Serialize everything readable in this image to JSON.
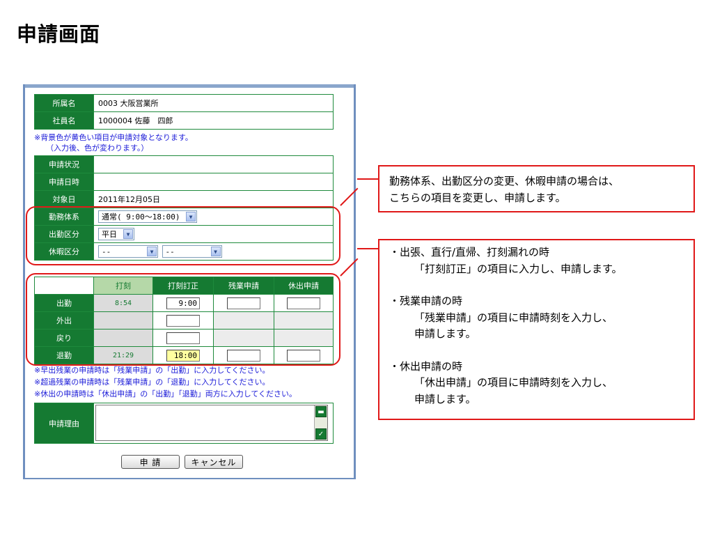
{
  "title": "申請画面",
  "form": {
    "affiliation": {
      "label": "所属名",
      "value": "0003 大阪営業所"
    },
    "employee": {
      "label": "社員名",
      "value": "1000004 佐藤　四郎"
    },
    "note_top_1": "※背景色が黄色い項目が申請対象となります。",
    "note_top_2": "（入力後、色が変わります。）",
    "status": {
      "label": "申請状況",
      "value": ""
    },
    "apply_date": {
      "label": "申請日時",
      "value": ""
    },
    "target_date": {
      "label": "対象日",
      "value": "2011年12月05日"
    },
    "work_system": {
      "label": "勤務体系",
      "value": "通常( 9:00～18:00)"
    },
    "attendance_type": {
      "label": "出勤区分",
      "value": "平日"
    },
    "leave_type": {
      "label": "休暇区分",
      "value1": "--",
      "value2": "--"
    }
  },
  "grid": {
    "headers": [
      "",
      "打刻",
      "打刻訂正",
      "残業申請",
      "休出申請"
    ],
    "rows": [
      {
        "label": "出勤",
        "actual": "8:54",
        "correction": "9:00",
        "overtime": "",
        "holiday": ""
      },
      {
        "label": "外出",
        "actual": "",
        "correction": "",
        "overtime": "",
        "holiday": ""
      },
      {
        "label": "戻り",
        "actual": "",
        "correction": "",
        "overtime": "",
        "holiday": ""
      },
      {
        "label": "退勤",
        "actual": "21:29",
        "correction": "18:00",
        "overtime": "",
        "holiday": ""
      }
    ]
  },
  "notes_bottom": [
    "※早出残業の申請時は「残業申請」の「出勤」に入力してください。",
    "※超過残業の申請時は「残業申請」の「退勤」に入力してください。",
    "※休出の申請時は「休出申請」の「出勤」「退勤」両方に入力してください。"
  ],
  "reason": {
    "label": "申請理由",
    "value": ""
  },
  "buttons": {
    "apply": "申 請",
    "cancel": "キャンセル"
  },
  "callout1": [
    "勤務体系、出勤区分の変更、休暇申請の場合は、",
    "こちらの項目を変更し、申請します。"
  ],
  "callout2": [
    "・出張、直行/直帰、打刻漏れの時",
    "「打刻訂正」の項目に入力し、申請します。",
    "",
    "・残業申請の時",
    "「残業申請」の項目に申請時刻を入力し、",
    "申請します。",
    "",
    "・休出申請の時",
    "「休出申請」の項目に申請時刻を入力し、",
    "申請します。"
  ],
  "colors": {
    "header_green": "#157a32",
    "highlight_red": "#e01818",
    "note_blue": "#1a1ad8",
    "input_yellow": "#ffffa0"
  }
}
